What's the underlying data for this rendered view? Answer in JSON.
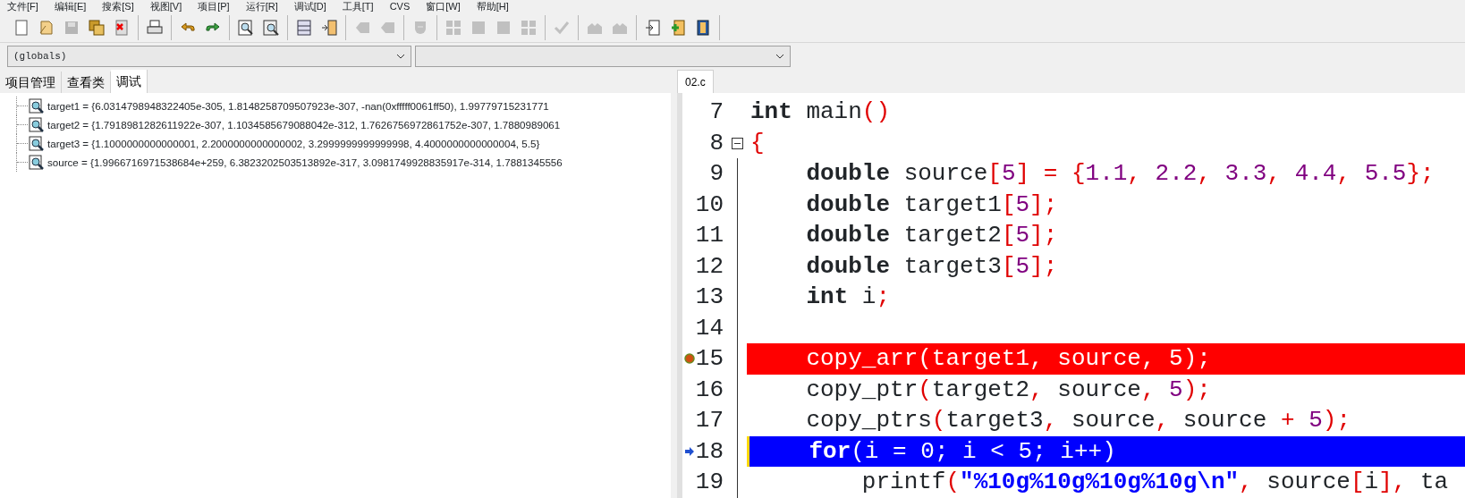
{
  "menu": [
    {
      "label": "文件[F]"
    },
    {
      "label": "编辑[E]"
    },
    {
      "label": "搜索[S]"
    },
    {
      "label": "视图[V]"
    },
    {
      "label": "项目[P]"
    },
    {
      "label": "运行[R]"
    },
    {
      "label": "调试[D]"
    },
    {
      "label": "工具[T]"
    },
    {
      "label": "CVS"
    },
    {
      "label": "窗口[W]"
    },
    {
      "label": "帮助[H]"
    }
  ],
  "toolbar": [
    [
      {
        "disabled": false
      },
      {
        "disabled": false
      },
      {
        "disabled": true
      },
      {
        "disabled": false
      },
      {
        "disabled": false
      }
    ],
    [
      {
        "disabled": false
      }
    ],
    [
      {
        "disabled": false
      },
      {
        "disabled": false
      }
    ],
    [
      {
        "disabled": false
      },
      {
        "disabled": false
      }
    ],
    [
      {
        "disabled": false
      },
      {
        "disabled": false
      }
    ],
    [
      {
        "disabled": true
      },
      {
        "disabled": true
      }
    ],
    [
      {
        "disabled": true
      }
    ],
    [
      {
        "disabled": true
      },
      {
        "disabled": true
      },
      {
        "disabled": true
      },
      {
        "disabled": true
      }
    ],
    [
      {
        "disabled": true
      }
    ],
    [
      {
        "disabled": true
      },
      {
        "disabled": true
      }
    ],
    [
      {
        "disabled": false
      },
      {
        "disabled": false
      },
      {
        "disabled": false
      }
    ]
  ],
  "scope_combo": {
    "value": "(globals)"
  },
  "left_tabs": [
    {
      "label": "项目管理",
      "selected": false
    },
    {
      "label": "查看类",
      "selected": false
    },
    {
      "label": "调试",
      "selected": true
    }
  ],
  "watches": [
    {
      "text": "target1 = {6.0314798948322405e-305, 1.8148258709507923e-307, -nan(0xfffff0061ff50), 1.99779715231771"
    },
    {
      "text": "target2 = {1.7918981282611922e-307, 1.1034585679088042e-312, 1.7626756972861752e-307, 1.7880989061"
    },
    {
      "text": "target3 = {1.1000000000000001, 2.2000000000000002, 3.2999999999999998, 4.4000000000000004, 5.5}"
    },
    {
      "text": "source = {1.9966716971538684e+259, 6.3823202503513892e-317, 3.0981749928835917e-314, 1.7881345556"
    }
  ],
  "editor_tabs": [
    {
      "label": "02.c",
      "selected": true
    }
  ],
  "code_lines": [
    {
      "number": "7",
      "breakpoint": false,
      "current": false,
      "fold_toggle": false,
      "text": "**int** main()"
    },
    {
      "number": "8",
      "breakpoint": false,
      "current": false,
      "fold_toggle": true,
      "text": "{"
    },
    {
      "number": "9",
      "breakpoint": false,
      "current": false,
      "fold_toggle": false,
      "text": "    **double** source[5] = {1.1, 2.2, 3.3, 4.4, 5.5};"
    },
    {
      "number": "10",
      "breakpoint": false,
      "current": false,
      "fold_toggle": false,
      "text": "    **double** target1[5];"
    },
    {
      "number": "11",
      "breakpoint": false,
      "current": false,
      "fold_toggle": false,
      "text": "    **double** target2[5];"
    },
    {
      "number": "12",
      "breakpoint": false,
      "current": false,
      "fold_toggle": false,
      "text": "    **double** target3[5];"
    },
    {
      "number": "13",
      "breakpoint": false,
      "current": false,
      "fold_toggle": false,
      "text": "    **int** i;"
    },
    {
      "number": "14",
      "breakpoint": false,
      "current": false,
      "fold_toggle": false
    },
    {
      "number": "15",
      "breakpoint": true,
      "current": false,
      "fold_toggle": false,
      "text": "    copy_arr(target1, source, 5);"
    },
    {
      "number": "16",
      "breakpoint": false,
      "current": false,
      "fold_toggle": false,
      "text": "    copy_ptr(target2, source, 5);"
    },
    {
      "number": "17",
      "breakpoint": false,
      "current": false,
      "fold_toggle": false,
      "text": "    copy_ptrs(target3, source, source + 5);"
    },
    {
      "number": "18",
      "breakpoint": false,
      "current": true,
      "fold_toggle": false,
      "text": "    **for**(i = 0; i < 5; i++)"
    },
    {
      "number": "19",
      "breakpoint": false,
      "current": false,
      "fold_toggle": false,
      "text": "        printf(**\"%10g%10g%10g%10g\\n\"**, source[i], ta"
    }
  ]
}
